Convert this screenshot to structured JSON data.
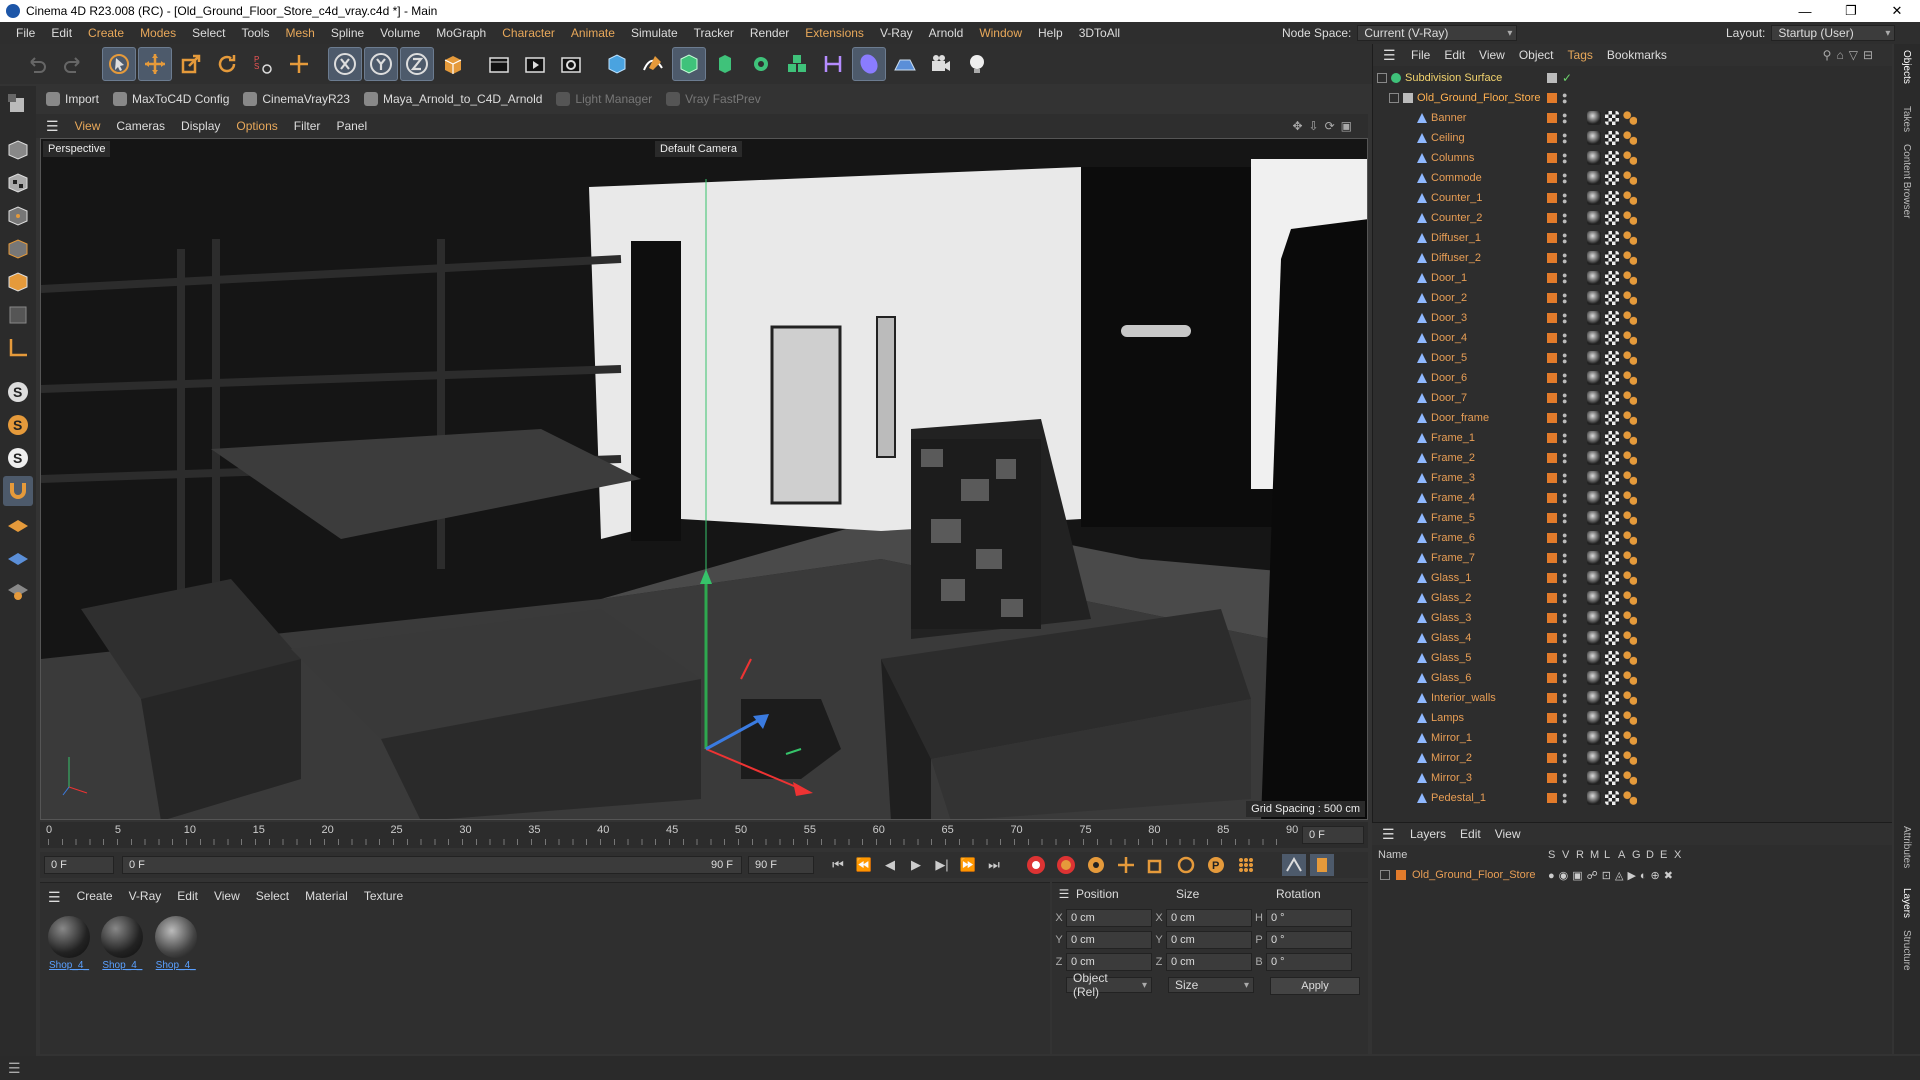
{
  "title": "Cinema 4D R23.008 (RC) - [Old_Ground_Floor_Store_c4d_vray.c4d *] - Main",
  "menu": [
    "File",
    "Edit",
    "Create",
    "Modes",
    "Select",
    "Tools",
    "Mesh",
    "Spline",
    "Volume",
    "MoGraph",
    "Character",
    "Animate",
    "Simulate",
    "Tracker",
    "Render",
    "Extensions",
    "V-Ray",
    "Arnold",
    "Window",
    "Help",
    "3DToAll"
  ],
  "node_space": {
    "label": "Node Space:",
    "value": "Current (V-Ray)"
  },
  "layout": {
    "label": "Layout:",
    "value": "Startup (User)"
  },
  "plugins": [
    "Import",
    "MaxToC4D Config",
    "CinemaVrayR23",
    "Maya_Arnold_to_C4D_Arnold",
    "Light Manager",
    "Vray FastPrev"
  ],
  "viewport_menu": [
    "View",
    "Cameras",
    "Display",
    "Options",
    "Filter",
    "Panel"
  ],
  "viewport": {
    "label": "Perspective",
    "camera": "Default Camera",
    "grid": "Grid Spacing : 500 cm"
  },
  "timeline": {
    "ticks": [
      "0",
      "5",
      "10",
      "15",
      "20",
      "25",
      "30",
      "35",
      "40",
      "45",
      "50",
      "55",
      "60",
      "65",
      "70",
      "75",
      "80",
      "85",
      "90"
    ],
    "end_field": "0 F"
  },
  "transport": {
    "start": "0 F",
    "current": "0 F",
    "range_end": "90 F",
    "end": "90 F"
  },
  "material_menu": [
    "Create",
    "V-Ray",
    "Edit",
    "View",
    "Select",
    "Material",
    "Texture"
  ],
  "materials": [
    "Shop_4_",
    "Shop_4_",
    "Shop_4_"
  ],
  "attributes": {
    "headers": [
      "Position",
      "Size",
      "Rotation"
    ],
    "rows": [
      {
        "a": "X",
        "pos": "0 cm",
        "b": "X",
        "size": "0 cm",
        "c": "H",
        "rot": "0 °"
      },
      {
        "a": "Y",
        "pos": "0 cm",
        "b": "Y",
        "size": "0 cm",
        "c": "P",
        "rot": "0 °"
      },
      {
        "a": "Z",
        "pos": "0 cm",
        "b": "Z",
        "size": "0 cm",
        "c": "B",
        "rot": "0 °"
      }
    ],
    "mode": "Object (Rel)",
    "size_mode": "Size",
    "apply": "Apply"
  },
  "object_menu": [
    "File",
    "Edit",
    "View",
    "Object",
    "Tags",
    "Bookmarks"
  ],
  "objects": {
    "top": "Subdivision Surface",
    "root": "Old_Ground_Floor_Store",
    "children": [
      "Banner",
      "Ceiling",
      "Columns",
      "Commode",
      "Counter_1",
      "Counter_2",
      "Diffuser_1",
      "Diffuser_2",
      "Door_1",
      "Door_2",
      "Door_3",
      "Door_4",
      "Door_5",
      "Door_6",
      "Door_7",
      "Door_frame",
      "Frame_1",
      "Frame_2",
      "Frame_3",
      "Frame_4",
      "Frame_5",
      "Frame_6",
      "Frame_7",
      "Glass_1",
      "Glass_2",
      "Glass_3",
      "Glass_4",
      "Glass_5",
      "Glass_6",
      "Interior_walls",
      "Lamps",
      "Mirror_1",
      "Mirror_2",
      "Mirror_3",
      "Pedestal_1"
    ]
  },
  "layers": {
    "menu": [
      "Layers",
      "Edit",
      "View"
    ],
    "name_header": "Name",
    "cols": [
      "S",
      "V",
      "R",
      "M",
      "L",
      "A",
      "G",
      "D",
      "E",
      "X"
    ],
    "items": [
      "Old_Ground_Floor_Store"
    ]
  },
  "right_tabs": [
    "Objects",
    "Takes",
    "Content Browser",
    "Attributes",
    "Layers",
    "Structure"
  ]
}
